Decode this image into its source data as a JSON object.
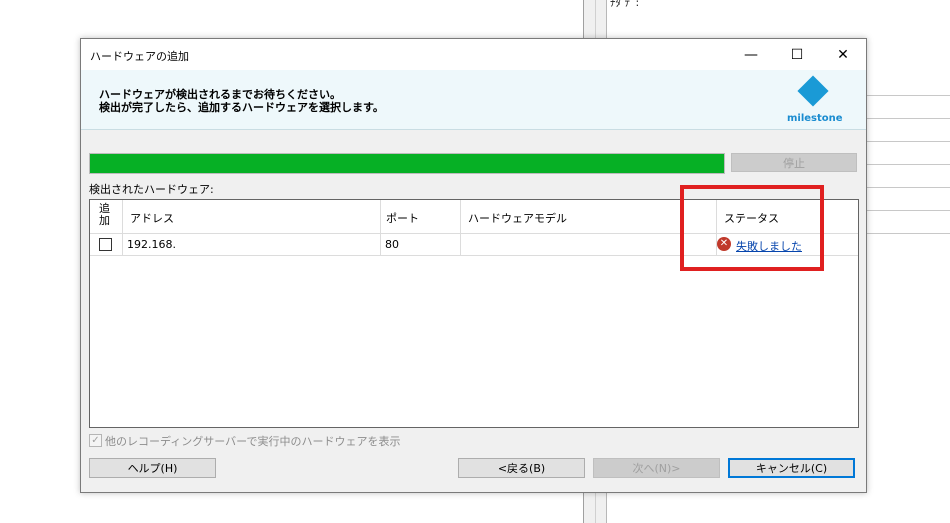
{
  "background": {
    "label": "ﾁﾀ ﾃﾞ:"
  },
  "dialog": {
    "title": "ハードウェアの追加",
    "controls": {
      "minimize": "—",
      "maximize": "☐",
      "close": "✕"
    },
    "header": {
      "line1": "ハードウェアが検出されるまでお待ちください。",
      "line2": "検出が完了したら、追加するハードウェアを選択します。",
      "logo_text": "milestone",
      "logo_color": "#1a9ad6"
    },
    "progress": {
      "value_percent": 100,
      "fill_color": "#06b025"
    },
    "stop_button": "停止",
    "section_label": "検出されたハードウェア:",
    "table": {
      "headers": {
        "add": "追\n加",
        "address": "アドレス",
        "port": "ポート",
        "model": "ハードウェアモデル",
        "status": "ステータス"
      },
      "rows": [
        {
          "checked": false,
          "address": "192.168.",
          "port": "80",
          "model": "",
          "status_icon": "error-icon",
          "status": "失敗しました"
        }
      ]
    },
    "show_running_label": "他のレコーディングサーバーで実行中のハードウェアを表示",
    "buttons": {
      "help": "ヘルプ(H)",
      "back": "<戻る(B)",
      "next": "次へ(N)>",
      "cancel": "キャンセル(C)"
    }
  }
}
